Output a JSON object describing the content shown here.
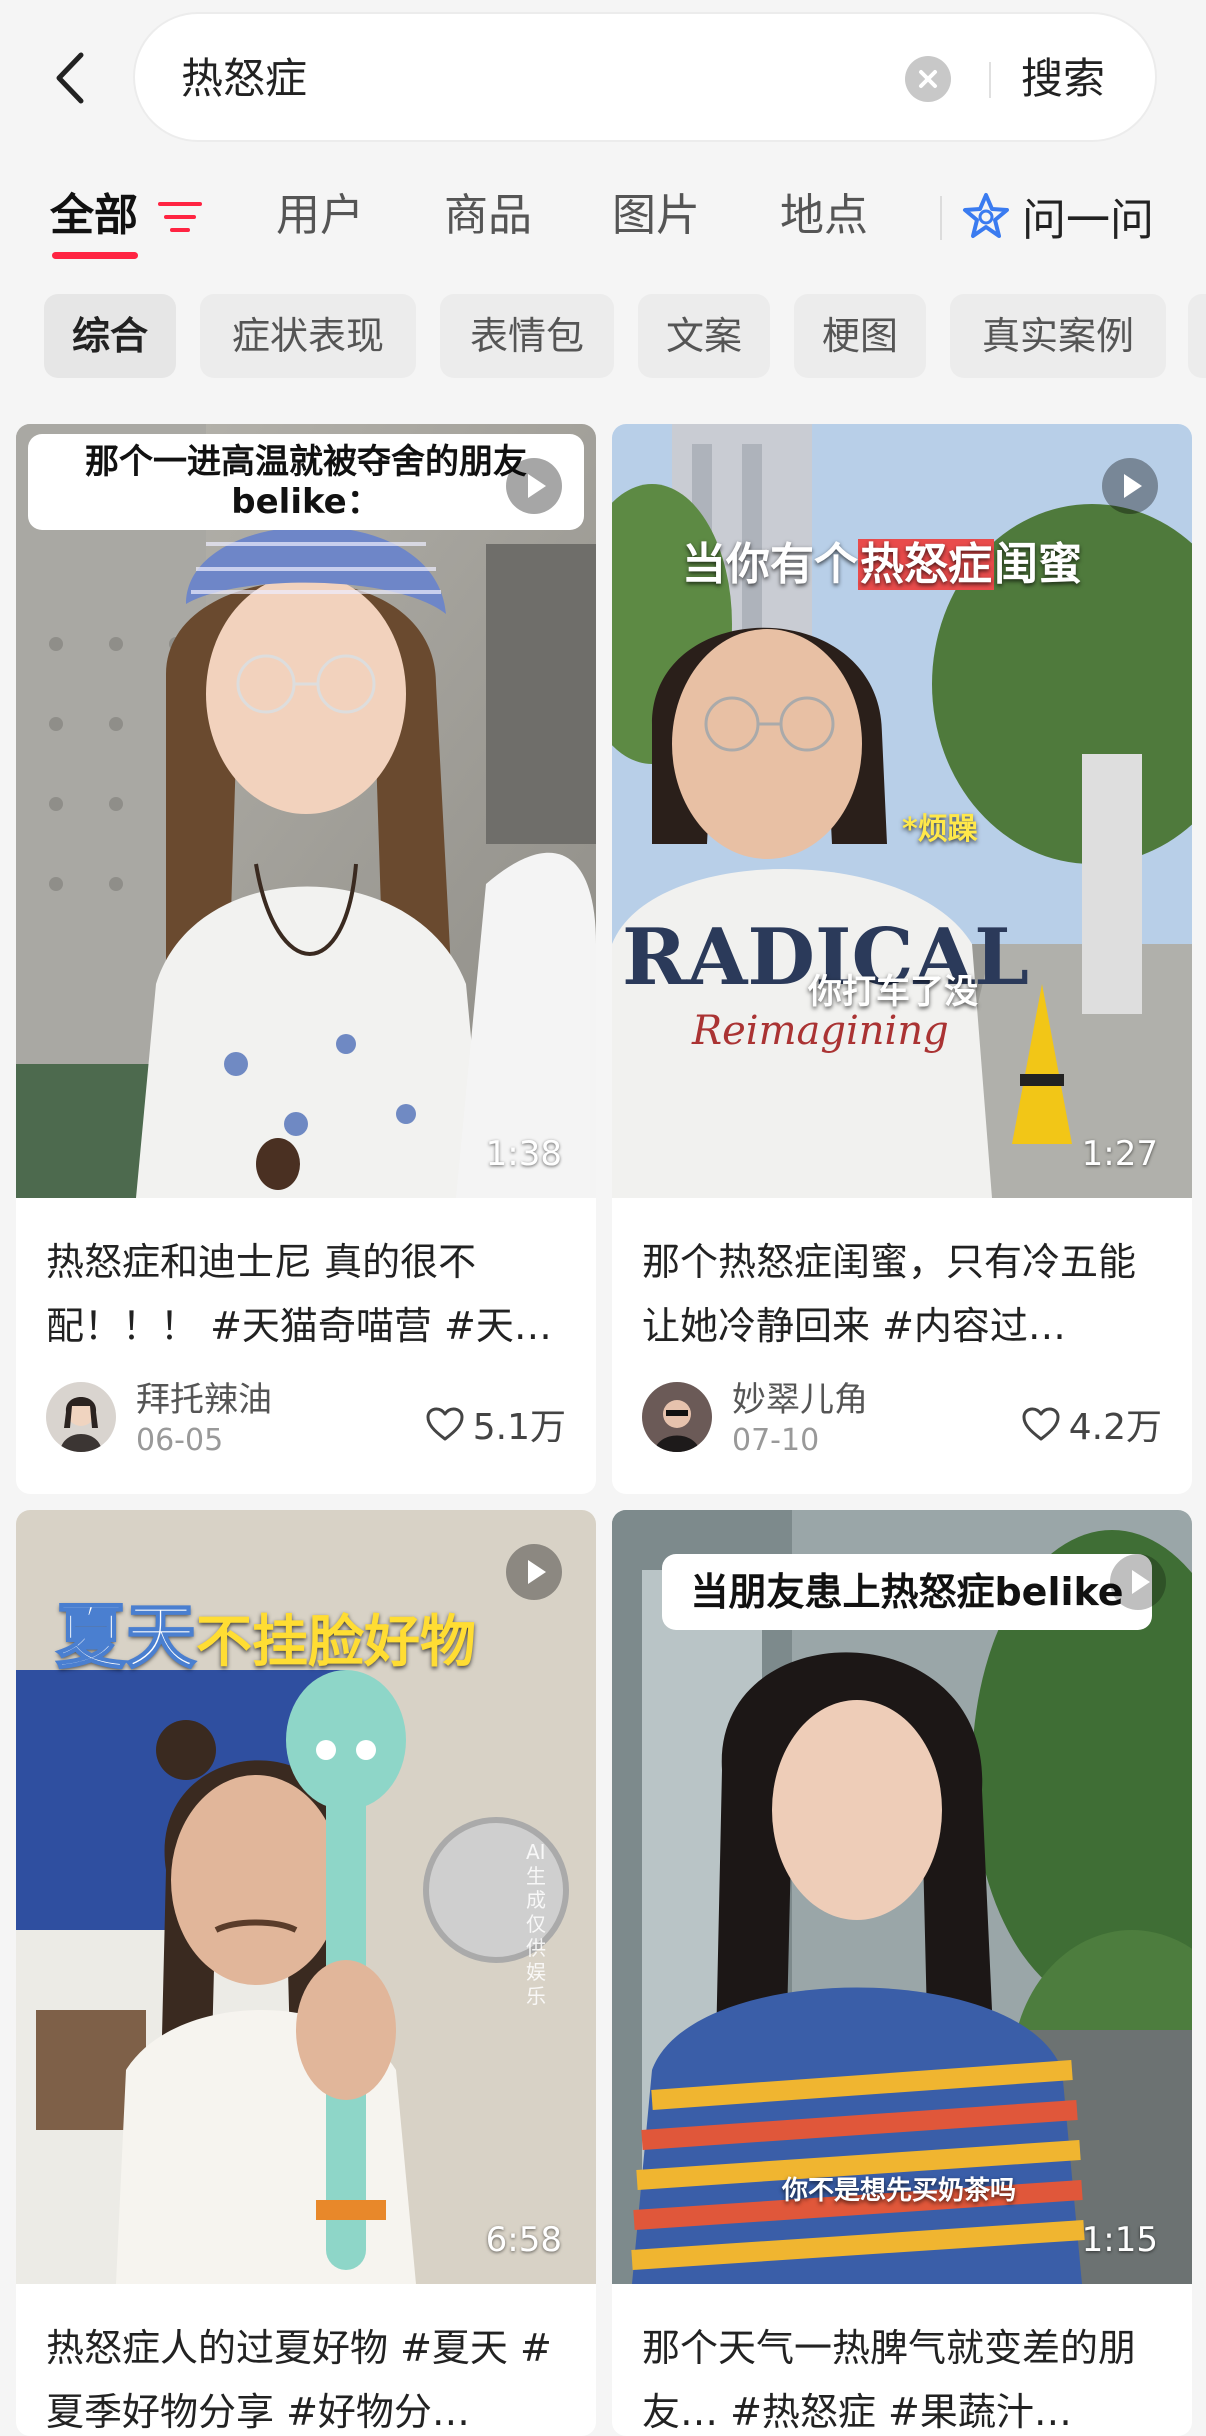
{
  "search": {
    "query": "热怒症",
    "button": "搜索"
  },
  "tabs": {
    "all": "全部",
    "users": "用户",
    "goods": "商品",
    "images": "图片",
    "places": "地点",
    "ask": "问一问"
  },
  "chips": [
    "综合",
    "症状表现",
    "表情包",
    "文案",
    "梗图",
    "真实案例"
  ],
  "colors": {
    "accent": "#ff2442",
    "ask_icon": "#3a7bf0"
  },
  "posts": [
    {
      "overlay": "那个一进高温就被夺舍的朋友\nbelike：",
      "duration": "1:38",
      "title": "热怒症和迪士尼 真的很不配！！！ #天猫奇喵营 #天…",
      "author": "拜托辣油",
      "date": "06-05",
      "likes": "5.1万"
    },
    {
      "overlay_parts": [
        "当你有个",
        "热怒症",
        "闺蜜"
      ],
      "captions": [
        "*烦躁",
        "你打车了没"
      ],
      "duration": "1:27",
      "title": "那个热怒症闺蜜，只有冷五能让她冷静回来 #内容过…",
      "author": "妙翠儿角",
      "date": "07-10",
      "likes": "4.2万"
    },
    {
      "overlay_parts": [
        "夏天",
        "不挂脸好物"
      ],
      "watermark": "AI生成 仅供娱乐",
      "duration": "6:58",
      "title": "热怒症人的过夏好物 #夏天 #夏季好物分享 #好物分…"
    },
    {
      "overlay": "当朋友患上热怒症belike",
      "captions": [
        "你不是想先买奶茶吗"
      ],
      "duration": "1:15",
      "title": "那个天气一热脾气就变差的朋友… #热怒症 #果蔬汁…"
    }
  ]
}
